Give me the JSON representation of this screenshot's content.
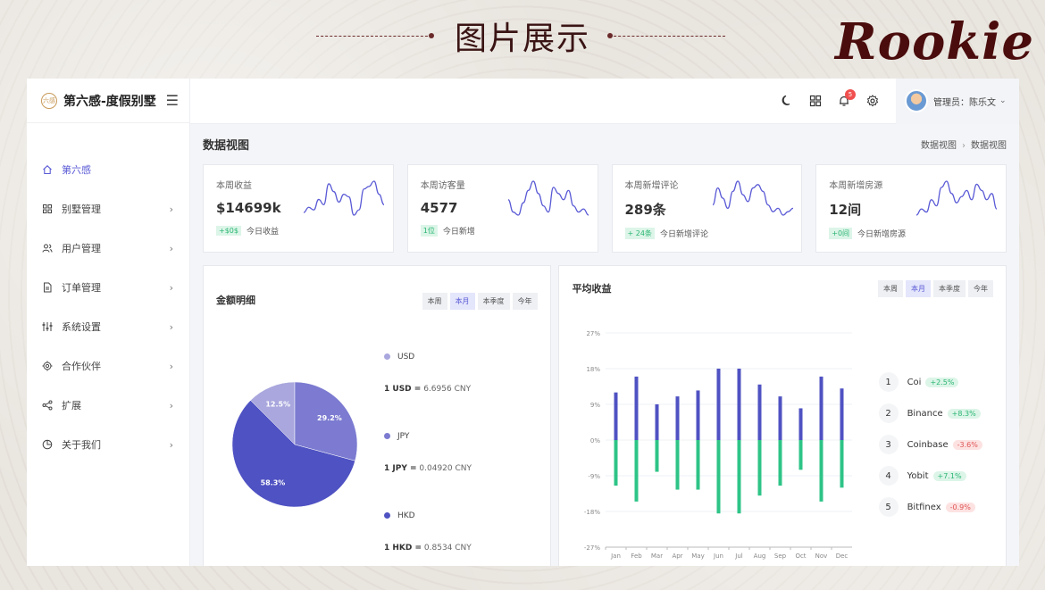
{
  "slide": {
    "title": "图片展示",
    "brand": "Rookie"
  },
  "sidebar": {
    "logo_badge": "六感",
    "logo": "第六感-度假别墅",
    "items": [
      {
        "label": "第六感",
        "icon": "home-icon",
        "active": true
      },
      {
        "label": "别墅管理",
        "icon": "grid-icon"
      },
      {
        "label": "用户管理",
        "icon": "users-icon"
      },
      {
        "label": "订单管理",
        "icon": "document-icon"
      },
      {
        "label": "系统设置",
        "icon": "sliders-icon"
      },
      {
        "label": "合作伙伴",
        "icon": "chip-icon"
      },
      {
        "label": "扩展",
        "icon": "share-icon"
      },
      {
        "label": "关于我们",
        "icon": "pie-icon"
      }
    ]
  },
  "topbar": {
    "notification_count": "5",
    "user": "管理员：陈乐文"
  },
  "page": {
    "title": "数据视图",
    "breadcrumb": [
      "数据视图",
      "数据视图"
    ]
  },
  "stats": [
    {
      "label": "本周收益",
      "value": "$14699k",
      "tag": "+$0$",
      "note": "今日收益"
    },
    {
      "label": "本周访客量",
      "value": "4577",
      "tag": "1位",
      "note": "今日新增"
    },
    {
      "label": "本周新增评论",
      "value": "289条",
      "tag": "+ 24条",
      "note": "今日新增评论"
    },
    {
      "label": "本周新增房源",
      "value": "12间",
      "tag": "+0间",
      "note": "今日新增房源"
    }
  ],
  "amount_card": {
    "title": "金额明细",
    "periods": [
      "本周",
      "本月",
      "本季度",
      "今年"
    ],
    "selected_period": "本月",
    "currencies": [
      {
        "name": "USD",
        "rate_label": "1 USD =",
        "rate_value": "6.6956 CNY",
        "color": "#a9a7dd"
      },
      {
        "name": "JPY",
        "rate_label": "1 JPY =",
        "rate_value": "0.04920 CNY",
        "color": "#7c7bd1"
      },
      {
        "name": "HKD",
        "rate_label": "1 HKD =",
        "rate_value": "0.8534 CNY",
        "color": "#4f52c2"
      }
    ]
  },
  "avg_card": {
    "title": "平均收益",
    "periods": [
      "本周",
      "本月",
      "本季度",
      "今年"
    ],
    "selected_period": "本月",
    "ranking": [
      {
        "rank": "1",
        "name": "Coi",
        "change": "+2.5%",
        "dir": "up"
      },
      {
        "rank": "2",
        "name": "Binance",
        "change": "+8.3%",
        "dir": "up"
      },
      {
        "rank": "3",
        "name": "Coinbase",
        "change": "-3.6%",
        "dir": "down"
      },
      {
        "rank": "4",
        "name": "Yobit",
        "change": "+7.1%",
        "dir": "up"
      },
      {
        "rank": "5",
        "name": "Bitfinex",
        "change": "-0.9%",
        "dir": "down"
      }
    ]
  },
  "chart_data": [
    {
      "type": "pie",
      "labels": [
        "",
        "",
        ""
      ],
      "values": [
        12.5,
        29.2,
        58.3
      ],
      "value_labels": [
        "12.5%",
        "29.2%",
        "58.3%"
      ],
      "colors": [
        "#a9a7dd",
        "#7c7bd1",
        "#4f52c2"
      ]
    },
    {
      "type": "bar",
      "categories": [
        "Jan",
        "Feb",
        "Mar",
        "Apr",
        "May",
        "Jun",
        "Jul",
        "Aug",
        "Sep",
        "Oct",
        "Nov",
        "Dec"
      ],
      "series": [
        {
          "values": [
            12,
            16,
            9,
            11,
            12.5,
            18,
            18,
            14,
            11,
            8,
            16,
            13
          ]
        },
        {
          "values": [
            -11.5,
            -15.5,
            -8,
            -12.5,
            -12.5,
            -18.5,
            -18.5,
            -14,
            -11.5,
            -7.5,
            -15.5,
            -12
          ]
        }
      ],
      "colors": [
        "#4f52c2",
        "#2ec487"
      ],
      "y_ticks": [
        "27%",
        "18%",
        "9%",
        "0%",
        "-9%",
        "-18%",
        "-27%"
      ],
      "ylim": [
        -27,
        27
      ]
    }
  ],
  "sparklines": [
    [
      4,
      6,
      5,
      9,
      7,
      15,
      12,
      8,
      11,
      10,
      3,
      5,
      13,
      14,
      16,
      11,
      7
    ],
    [
      9,
      5,
      4,
      8,
      12,
      15,
      11,
      7,
      5,
      13,
      11,
      9,
      12,
      7,
      5,
      6,
      4
    ],
    [
      6,
      11,
      8,
      5,
      10,
      13,
      9,
      7,
      11,
      12,
      10,
      6,
      4,
      5,
      3,
      4,
      5
    ],
    [
      4,
      6,
      5,
      9,
      7,
      13,
      15,
      11,
      8,
      10,
      12,
      9,
      14,
      12,
      9,
      11,
      6
    ]
  ]
}
